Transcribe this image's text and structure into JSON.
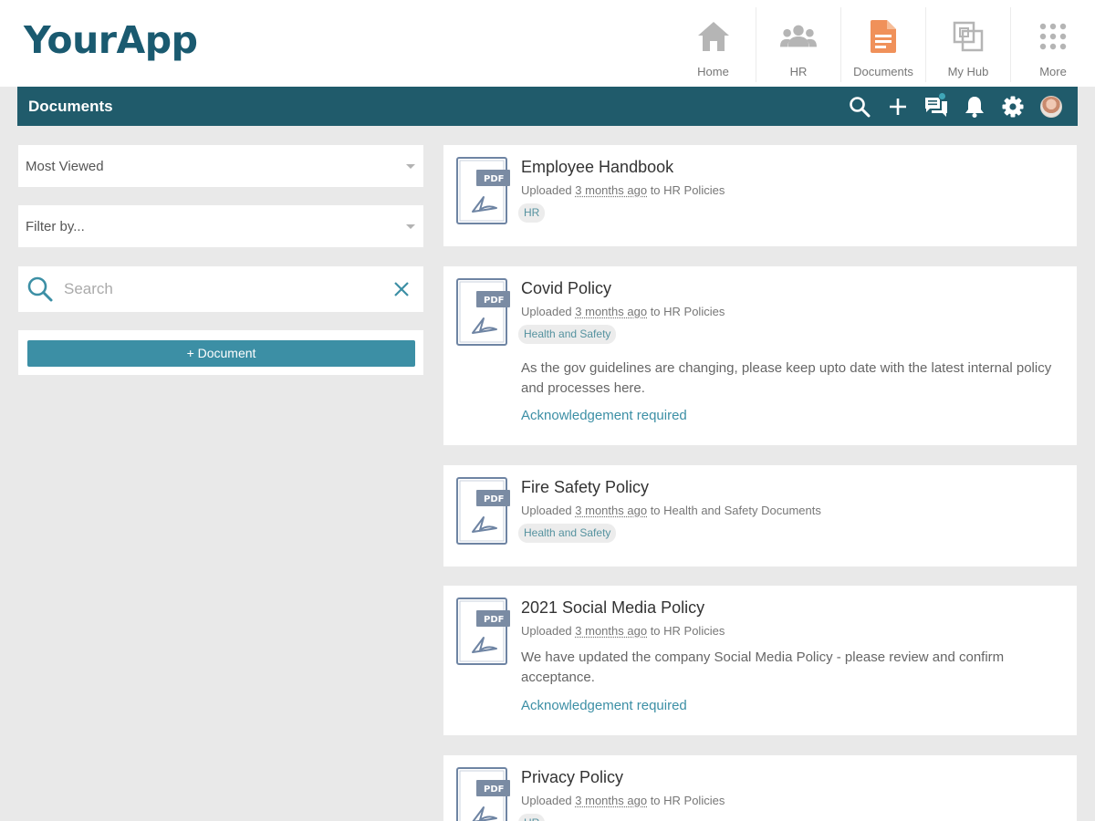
{
  "app": {
    "logo_text": "YourApp"
  },
  "nav": {
    "items": [
      {
        "label": "Home",
        "icon": "home-icon",
        "active": false
      },
      {
        "label": "HR",
        "icon": "people-icon",
        "active": false
      },
      {
        "label": "Documents",
        "icon": "document-icon",
        "active": true
      },
      {
        "label": "My Hub",
        "icon": "hub-icon",
        "active": false
      },
      {
        "label": "More",
        "icon": "grid-icon",
        "active": false
      }
    ]
  },
  "titlebar": {
    "title": "Documents",
    "icons": [
      "search-icon",
      "plus-icon",
      "chat-icon",
      "bell-icon",
      "gear-icon",
      "avatar"
    ]
  },
  "filters": {
    "sort_value": "Most Viewed",
    "filter_value": "Filter by...",
    "search_placeholder": "Search",
    "search_value": "",
    "add_button_label": "+ Document"
  },
  "documents": [
    {
      "title": "Employee Handbook",
      "uploaded_prefix": "Uploaded",
      "ago": "3 months ago",
      "to_text": "to HR Policies",
      "tag": "HR",
      "file_type": "PDF"
    },
    {
      "title": "Covid Policy",
      "uploaded_prefix": "Uploaded",
      "ago": "3 months ago",
      "to_text": "to HR Policies",
      "tag": "Health and Safety",
      "file_type": "PDF",
      "description": "As the gov guidelines are changing, please keep upto date with the latest internal policy and processes here.",
      "action": "Acknowledgement required"
    },
    {
      "title": "Fire Safety Policy",
      "uploaded_prefix": "Uploaded",
      "ago": "3 months ago",
      "to_text": "to Health and Safety Documents",
      "tag": "Health and Safety",
      "file_type": "PDF"
    },
    {
      "title": "2021 Social Media Policy",
      "uploaded_prefix": "Uploaded",
      "ago": "3 months ago",
      "to_text": "to HR Policies",
      "file_type": "PDF",
      "description": "We have updated the company Social Media Policy - please review and confirm acceptance.",
      "action": "Acknowledgement required"
    },
    {
      "title": "Privacy Policy",
      "uploaded_prefix": "Uploaded",
      "ago": "3 months ago",
      "to_text": "to HR Policies",
      "tag": "HR",
      "file_type": "PDF"
    }
  ],
  "colors": {
    "brand": "#1a5a70",
    "titlebar": "#205b6b",
    "accent": "#3c8fa5",
    "active_nav": "#f0915a",
    "nav_icon": "#b5b5b5"
  }
}
